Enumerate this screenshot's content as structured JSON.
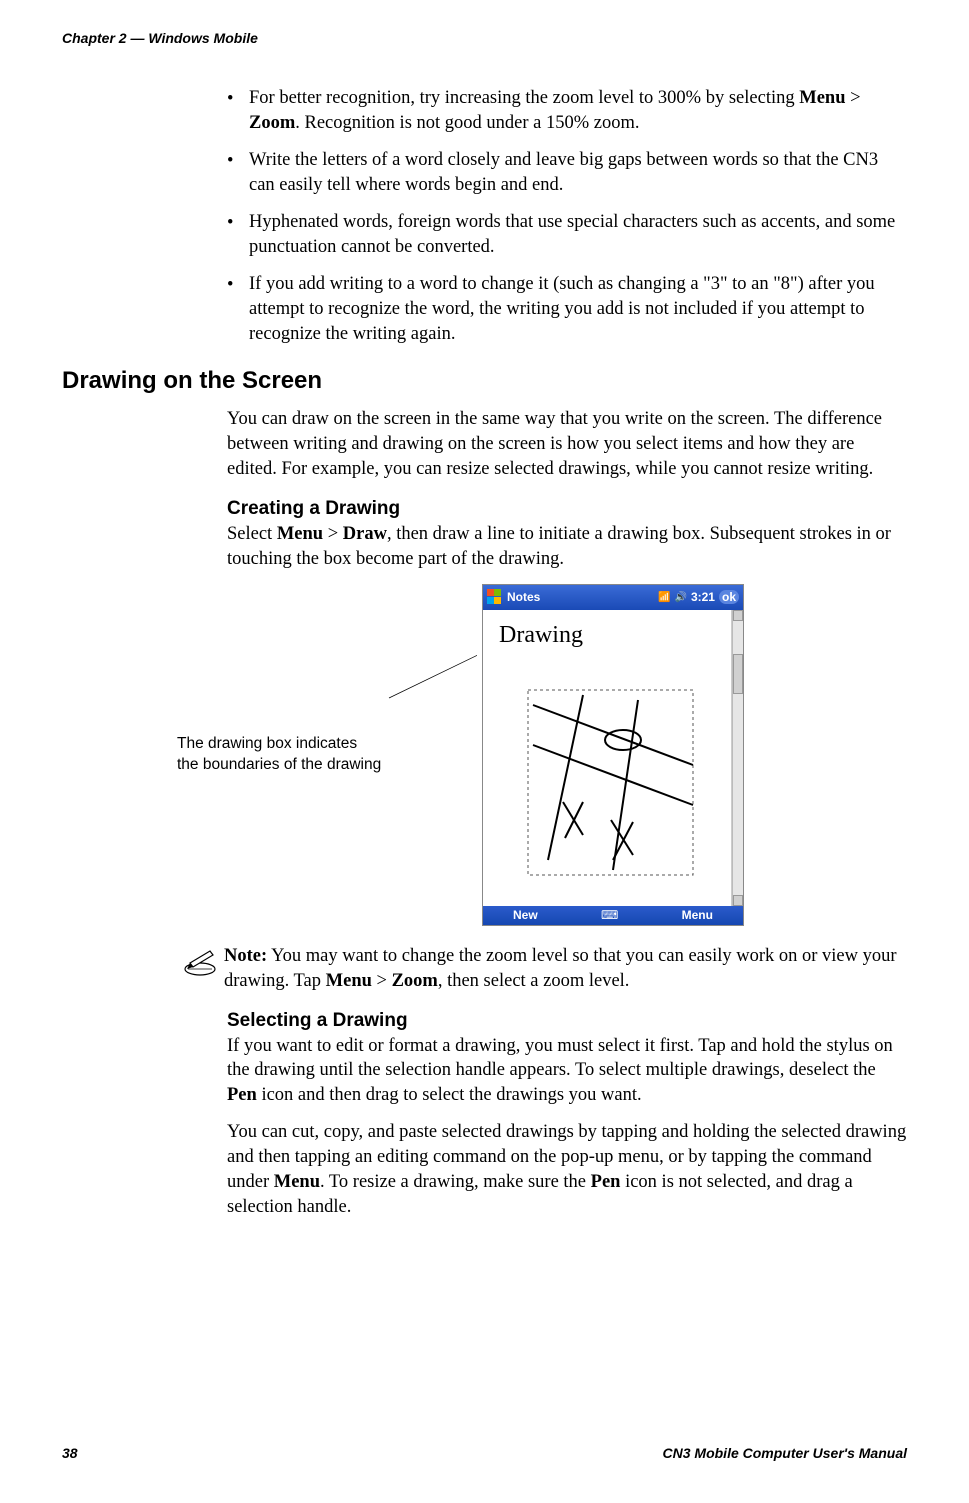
{
  "header": {
    "chapter": "Chapter 2 — Windows Mobile"
  },
  "bullets": {
    "b0_pre": "For better recognition, try increasing the zoom level to 300% by selecting ",
    "b0_bold1": "Menu",
    "b0_mid1": " > ",
    "b0_bold2": "Zoom",
    "b0_post": ". Recognition is not good under a 150% zoom.",
    "b1": "Write the letters of a word closely and leave big gaps between words so that the CN3 can easily tell where words begin and end.",
    "b2": "Hyphenated words, foreign words that use special characters such as accents, and some punctuation cannot be converted.",
    "b3": "If you add writing to a word to change it (such as changing a \"3\" to an \"8\") after you attempt to recognize the word, the writing you add is not included if you attempt to recognize the writing again."
  },
  "section": {
    "h2": "Drawing on the Screen",
    "intro": "You can draw on the screen in the same way that you write on the screen. The difference between writing and drawing on the screen is how you select items and how they are edited. For example, you can resize selected drawings, while you cannot resize writing.",
    "h3_creating": "Creating a Drawing",
    "creating_pre": "Select ",
    "creating_b1": "Menu",
    "creating_mid": " > ",
    "creating_b2": "Draw",
    "creating_post": ", then draw a line to initiate a drawing box. Subsequent strokes in or touching the box become part of the drawing.",
    "caption_line1": "The drawing box indicates",
    "caption_line2": "the boundaries of the drawing",
    "note_label": "Note:",
    "note_pre": " You may want to change the zoom level so that you can easily work on or view your drawing. Tap ",
    "note_b1": "Menu",
    "note_mid": " > ",
    "note_b2": "Zoom",
    "note_post": ", then select a zoom level.",
    "h3_selecting": "Selecting a Drawing",
    "selecting_p1_pre": "If you want to edit or format a drawing, you must select it first. Tap and hold the stylus on the drawing until the selection handle appears. To select multiple drawings, deselect the ",
    "selecting_p1_b": "Pen",
    "selecting_p1_post": " icon and then drag to select the drawings you want.",
    "selecting_p2_pre": "You can cut, copy, and paste selected drawings by tapping and holding the selected drawing and then tapping an editing command on the pop-up menu, or by tapping the command under ",
    "selecting_p2_b1": "Menu",
    "selecting_p2_mid": ". To resize a drawing, make sure the ",
    "selecting_p2_b2": "Pen",
    "selecting_p2_post": " icon is not selected, and drag a selection handle."
  },
  "screenshot": {
    "app_title": "Notes",
    "time": "3:21",
    "ok": "ok",
    "drawing_label": "Drawing",
    "btn_new": "New",
    "btn_menu": "Menu"
  },
  "footer": {
    "page": "38",
    "manual": "CN3 Mobile Computer User's Manual"
  }
}
